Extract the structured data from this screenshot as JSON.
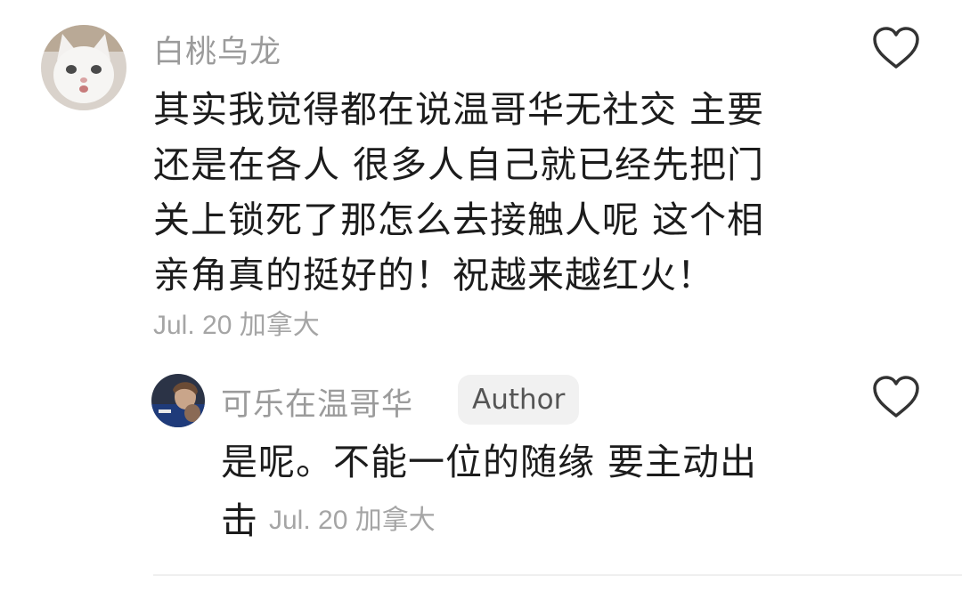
{
  "comment": {
    "username": "白桃乌龙",
    "lines": [
      "其实我觉得都在说温哥华无社交 主要",
      "还是在各人 很多人自己就已经先把门",
      "关上锁死了那怎么去接触人呢 这个相",
      "亲角真的挺好的！祝越来越红火！"
    ],
    "meta": "Jul. 20 加拿大",
    "avatar_icon": "white-cat-avatar",
    "like_icon": "heart-outline-icon"
  },
  "reply": {
    "username": "可乐在温哥华",
    "badge": "Author",
    "line1": "是呢。不能一位的随缘 要主动出",
    "line2": "击",
    "meta": "Jul. 20 加拿大",
    "avatar_icon": "person-photo-avatar",
    "like_icon": "heart-outline-icon"
  },
  "colors": {
    "username": "#9b9b9b",
    "body_text": "#1c1c1c",
    "meta": "#a5a5a5",
    "badge_bg": "#f1f1f1",
    "heart_stroke": "#333333"
  }
}
